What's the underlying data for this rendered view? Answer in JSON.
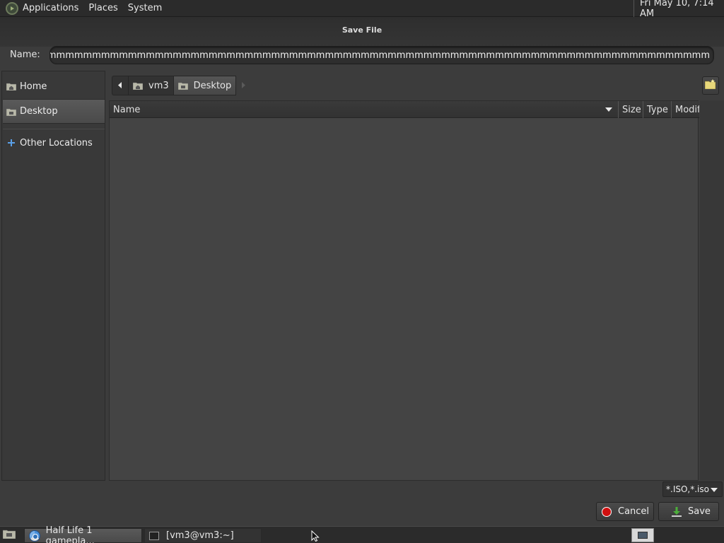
{
  "top_panel": {
    "menus": [
      "Applications",
      "Places",
      "System"
    ],
    "clock": "Fri May 10,  7:14 AM"
  },
  "dialog": {
    "title": "Save File",
    "name_label": "Name:",
    "name_value": "nmmmmmmmmmmmmmmmmmmmmmmmmmmmmmmmmmmmmmmmmmmmmmmmmmmmmmmmmmmmmmmmmmmmmmmmmmmmmmmmmmmmmmm",
    "places": [
      {
        "label": "Home",
        "icon": "home-folder-icon"
      },
      {
        "label": "Desktop",
        "icon": "desktop-folder-icon",
        "selected": true
      },
      {
        "label": "Other Locations",
        "icon": "plus-icon"
      }
    ],
    "path": [
      {
        "label": "vm3",
        "icon": "home-folder-icon"
      },
      {
        "label": "Desktop",
        "icon": "desktop-folder-icon",
        "active": true
      }
    ],
    "columns": [
      "Name",
      "Size",
      "Type",
      "Modified"
    ],
    "files": [],
    "filter": "*.ISO,*.iso",
    "cancel_label": "Cancel",
    "save_label": "Save"
  },
  "taskbar": {
    "tasks": [
      "Half Life 1 gamepla...",
      "[vm3@vm3:~]"
    ]
  },
  "colors": {
    "panel_bg": "#2b2b2b",
    "dialog_bg": "#3c3c3c",
    "list_bg": "#444444",
    "cancel_red": "#d01010"
  }
}
